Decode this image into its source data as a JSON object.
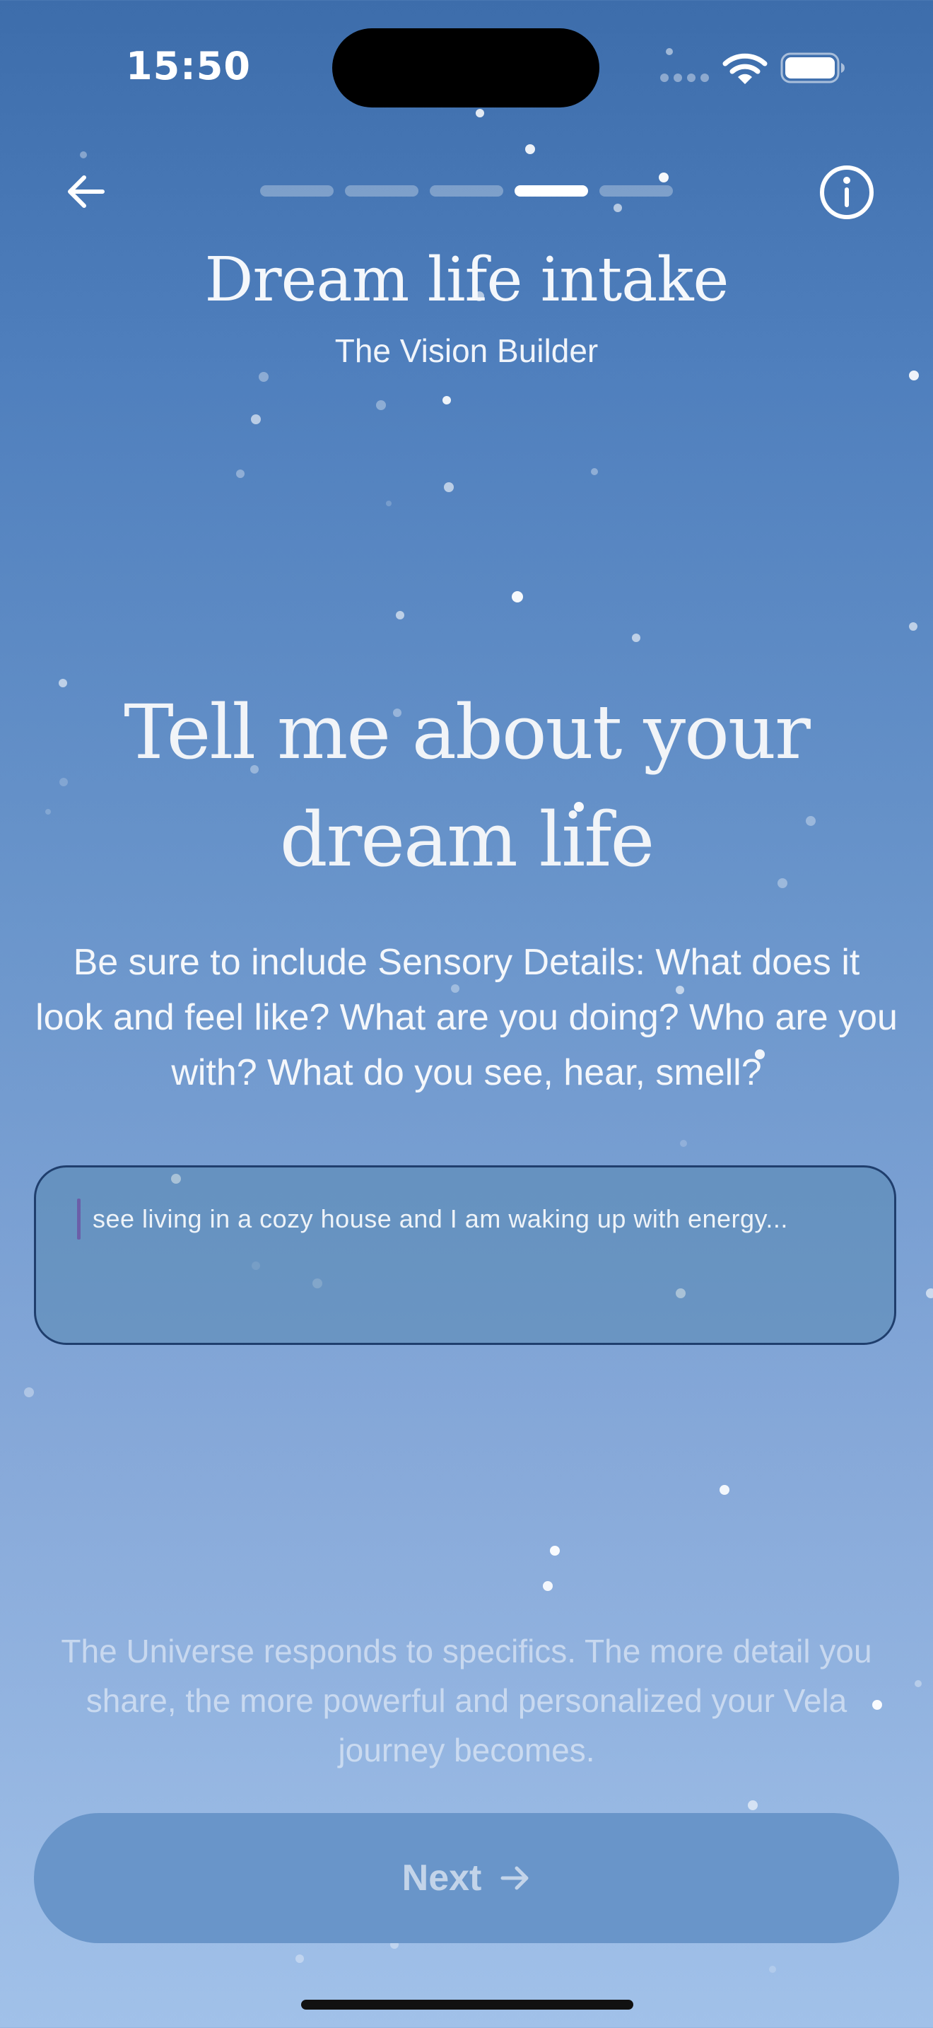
{
  "status_bar": {
    "time": "15:50",
    "icons": [
      "signal-icon",
      "wifi-icon",
      "battery-icon"
    ]
  },
  "nav": {
    "back_icon": "arrow-left-icon",
    "info_icon": "info-icon",
    "progress": {
      "total_steps": 5,
      "current_step": 4
    }
  },
  "header": {
    "title": "Dream life intake",
    "subtitle": "The Vision Builder"
  },
  "question": {
    "heading": "Tell me about your dream life",
    "instructions": "Be sure to include Sensory Details: What does  it look and feel like? What are you doing? Who are you with? What do you see, hear, smell?"
  },
  "input": {
    "value": "see living in a cozy house and I am waking up with energy..."
  },
  "footnote": "The Universe responds to specifics. The more detail you share, the more powerful and personalized your Vela journey becomes.",
  "next_button": {
    "label": "Next",
    "icon": "arrow-right-icon"
  },
  "colors": {
    "background_top": "#3d6dab",
    "background_bottom": "#a1c1e9",
    "button": "#6995c9",
    "input_border": "#1f3e6d",
    "caret": "#6b5fa8"
  }
}
